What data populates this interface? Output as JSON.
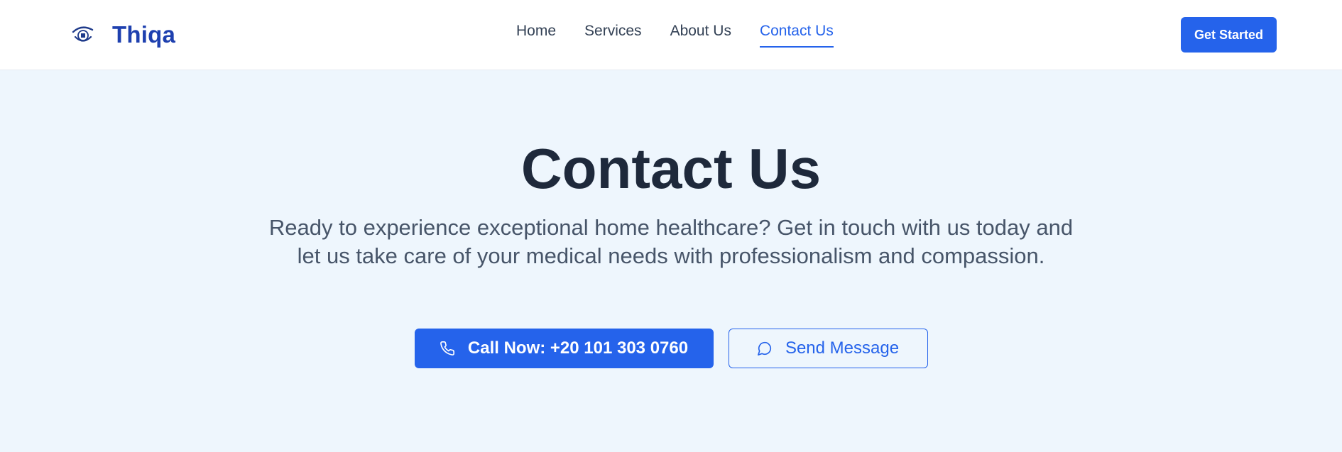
{
  "header": {
    "brand_name": "Thiqa",
    "nav": [
      {
        "label": "Home",
        "active": false
      },
      {
        "label": "Services",
        "active": false
      },
      {
        "label": "About Us",
        "active": false
      },
      {
        "label": "Contact Us",
        "active": true
      }
    ],
    "cta_label": "Get Started"
  },
  "hero": {
    "title": "Contact Us",
    "description": "Ready to experience exceptional home healthcare? Get in touch with us today and let us take care of your medical needs with professionalism and compassion.",
    "primary_button": {
      "label": "Call Now: +20 101 303 0760",
      "icon": "phone-icon"
    },
    "secondary_button": {
      "label": "Send Message",
      "icon": "message-icon"
    }
  },
  "colors": {
    "accent": "#2563eb",
    "brand": "#1e40af",
    "hero_background": "#eef6fd",
    "heading": "#1e293b",
    "body_text": "#475569"
  }
}
